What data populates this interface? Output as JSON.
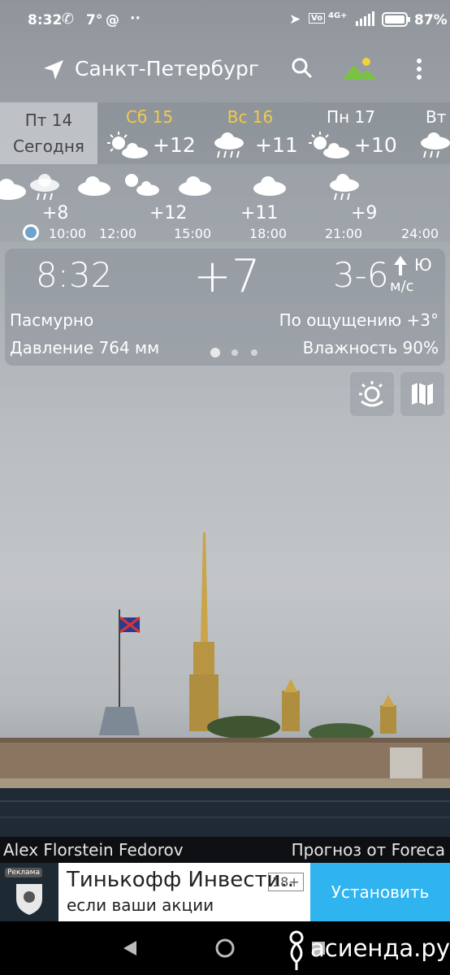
{
  "status": {
    "time": "8:32",
    "temp": "7°",
    "battery": "87%"
  },
  "header": {
    "city": "Санкт-Петербург"
  },
  "days": [
    {
      "name": "Пт 14",
      "sub": "Сегодня",
      "temp": "",
      "icon": "cloudy-icon",
      "color": "#ffffff"
    },
    {
      "name": "Сб 15",
      "sub": "",
      "temp": "+12",
      "icon": "sun-cloud-icon",
      "color": "#f2c94c"
    },
    {
      "name": "Вс 16",
      "sub": "",
      "temp": "+11",
      "icon": "rain-cloud-icon",
      "color": "#f2c94c"
    },
    {
      "name": "Пн 17",
      "sub": "",
      "temp": "+10",
      "icon": "sun-cloud-icon",
      "color": "#ffffff"
    },
    {
      "name": "Вт",
      "sub": "",
      "temp": "",
      "icon": "rain-cloud-icon",
      "color": "#ffffff"
    }
  ],
  "hourly": {
    "temps": [
      "+8",
      "+12",
      "+11",
      "+9"
    ],
    "times": [
      "10:00",
      "12:00",
      "15:00",
      "18:00",
      "21:00",
      "24:00"
    ]
  },
  "current": {
    "time": "8:32",
    "temp": "+7",
    "wind": "3-6",
    "wind_unit": "м/с",
    "wind_dir": "Ю",
    "condition": "Пасмурно",
    "feels": "По ощущению +3°",
    "pressure": "Давление 764 мм",
    "humidity": "Влажность 90%"
  },
  "credits": {
    "author": "Alex Florstein Fedorov",
    "source": "Прогноз от Foreca"
  },
  "ad": {
    "badge": "Реклама",
    "title": "Тинькофф Инвести..",
    "age": "18+",
    "subtitle": "если ваши акции",
    "cta": "Установить",
    "cta_color": "#2fb4f0"
  },
  "watermark": "асиенда.ру"
}
